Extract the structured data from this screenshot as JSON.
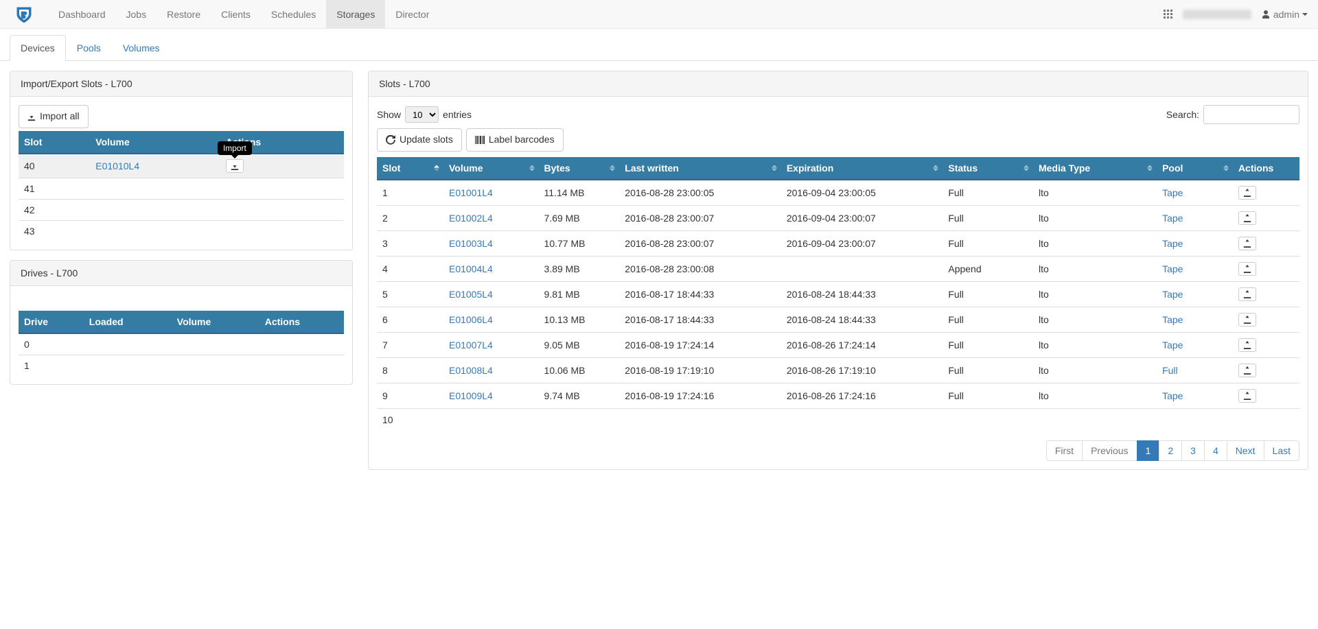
{
  "nav": {
    "items": [
      "Dashboard",
      "Jobs",
      "Restore",
      "Clients",
      "Schedules",
      "Storages",
      "Director"
    ],
    "active_index": 5,
    "user_label": "admin"
  },
  "tabs": {
    "items": [
      "Devices",
      "Pools",
      "Volumes"
    ],
    "active_index": 0
  },
  "import_export_panel": {
    "title": "Import/Export Slots - L700",
    "import_all_label": "Import all",
    "headers": {
      "slot": "Slot",
      "volume": "Volume",
      "actions": "Actions"
    },
    "rows": [
      {
        "slot": "40",
        "volume": "E01010L4",
        "has_action": true
      },
      {
        "slot": "41",
        "volume": "",
        "has_action": false
      },
      {
        "slot": "42",
        "volume": "",
        "has_action": false
      },
      {
        "slot": "43",
        "volume": "",
        "has_action": false
      }
    ],
    "tooltip_label": "Import"
  },
  "drives_panel": {
    "title": "Drives - L700",
    "headers": {
      "drive": "Drive",
      "loaded": "Loaded",
      "volume": "Volume",
      "actions": "Actions"
    },
    "rows": [
      {
        "drive": "0",
        "loaded": "",
        "volume": ""
      },
      {
        "drive": "1",
        "loaded": "",
        "volume": ""
      }
    ]
  },
  "slots_panel": {
    "title": "Slots - L700",
    "show_label": "Show",
    "entries_label": "entries",
    "page_length": "10",
    "search_label": "Search:",
    "update_slots_label": "Update slots",
    "label_barcodes_label": "Label barcodes",
    "headers": {
      "slot": "Slot",
      "volume": "Volume",
      "bytes": "Bytes",
      "last_written": "Last written",
      "expiration": "Expiration",
      "status": "Status",
      "media_type": "Media Type",
      "pool": "Pool",
      "actions": "Actions"
    },
    "rows": [
      {
        "slot": "1",
        "volume": "E01001L4",
        "bytes": "11.14 MB",
        "lw": "2016-08-28 23:00:05",
        "exp": "2016-09-04 23:00:05",
        "status": "Full",
        "media": "lto",
        "pool": "Tape"
      },
      {
        "slot": "2",
        "volume": "E01002L4",
        "bytes": "7.69 MB",
        "lw": "2016-08-28 23:00:07",
        "exp": "2016-09-04 23:00:07",
        "status": "Full",
        "media": "lto",
        "pool": "Tape"
      },
      {
        "slot": "3",
        "volume": "E01003L4",
        "bytes": "10.77 MB",
        "lw": "2016-08-28 23:00:07",
        "exp": "2016-09-04 23:00:07",
        "status": "Full",
        "media": "lto",
        "pool": "Tape"
      },
      {
        "slot": "4",
        "volume": "E01004L4",
        "bytes": "3.89 MB",
        "lw": "2016-08-28 23:00:08",
        "exp": "",
        "status": "Append",
        "media": "lto",
        "pool": "Tape"
      },
      {
        "slot": "5",
        "volume": "E01005L4",
        "bytes": "9.81 MB",
        "lw": "2016-08-17 18:44:33",
        "exp": "2016-08-24 18:44:33",
        "status": "Full",
        "media": "lto",
        "pool": "Tape"
      },
      {
        "slot": "6",
        "volume": "E01006L4",
        "bytes": "10.13 MB",
        "lw": "2016-08-17 18:44:33",
        "exp": "2016-08-24 18:44:33",
        "status": "Full",
        "media": "lto",
        "pool": "Tape"
      },
      {
        "slot": "7",
        "volume": "E01007L4",
        "bytes": "9.05 MB",
        "lw": "2016-08-19 17:24:14",
        "exp": "2016-08-26 17:24:14",
        "status": "Full",
        "media": "lto",
        "pool": "Tape"
      },
      {
        "slot": "8",
        "volume": "E01008L4",
        "bytes": "10.06 MB",
        "lw": "2016-08-19 17:19:10",
        "exp": "2016-08-26 17:19:10",
        "status": "Full",
        "media": "lto",
        "pool": "Full"
      },
      {
        "slot": "9",
        "volume": "E01009L4",
        "bytes": "9.74 MB",
        "lw": "2016-08-19 17:24:16",
        "exp": "2016-08-26 17:24:16",
        "status": "Full",
        "media": "lto",
        "pool": "Tape"
      },
      {
        "slot": "10",
        "volume": "",
        "bytes": "",
        "lw": "",
        "exp": "",
        "status": "",
        "media": "",
        "pool": ""
      }
    ],
    "pagination": {
      "first": "First",
      "previous": "Previous",
      "next": "Next",
      "last": "Last",
      "pages": [
        "1",
        "2",
        "3",
        "4"
      ],
      "active_page_index": 0
    }
  }
}
